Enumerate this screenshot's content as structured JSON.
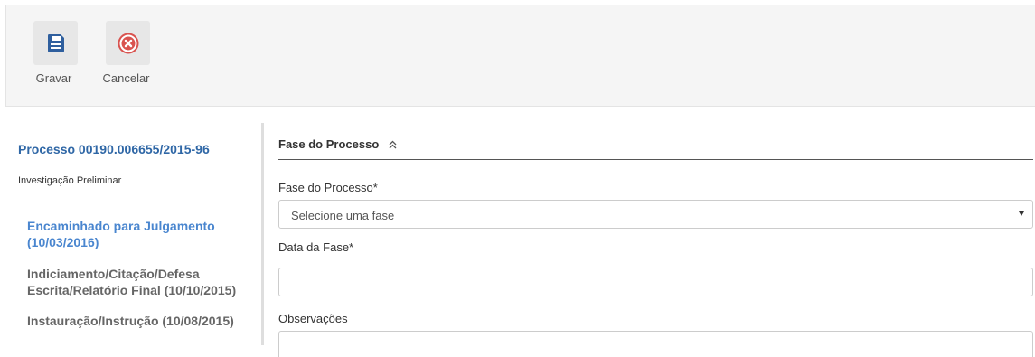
{
  "toolbar": {
    "save_label": "Gravar",
    "cancel_label": "Cancelar",
    "save_icon_color": "#2f5f9e",
    "cancel_icon_color": "#d9534f"
  },
  "process": {
    "number": "Processo 00190.006655/2015-96",
    "type": "Investigação Preliminar",
    "phases": [
      {
        "label": "Encaminhado para Julgamento (10/03/2016)",
        "active": true
      },
      {
        "label": "Indiciamento/Citação/Defesa Escrita/Relatório Final (10/10/2015)",
        "active": false
      },
      {
        "label": "Instauração/Instrução (10/08/2015)",
        "active": false
      }
    ]
  },
  "form": {
    "section_title": "Fase do Processo",
    "section_icon": "double-chevron-up-icon",
    "phase_label": "Fase do Processo*",
    "phase_select_value": "Selecione uma fase",
    "date_label": "Data da Fase*",
    "date_value": "",
    "notes_label": "Observações",
    "notes_value": ""
  }
}
